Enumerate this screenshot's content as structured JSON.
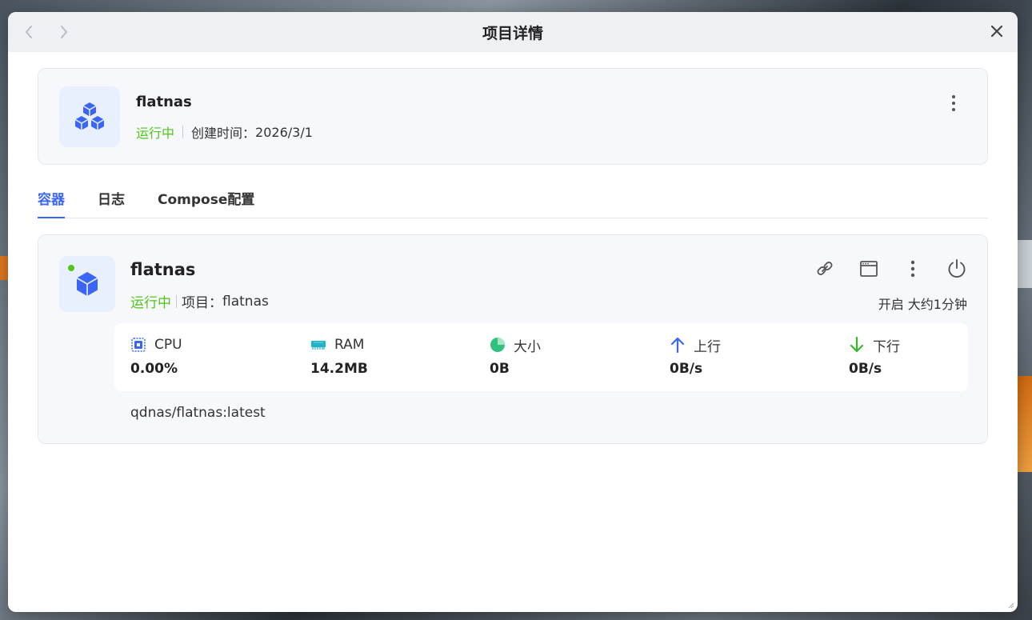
{
  "window": {
    "title": "项目详情"
  },
  "project": {
    "name": "flatnas",
    "status": "运行中",
    "created_label": "创建时间：",
    "created_value": "2026/3/1"
  },
  "tabs": [
    {
      "label": "容器",
      "active": true
    },
    {
      "label": "日志",
      "active": false
    },
    {
      "label": "Compose配置",
      "active": false
    }
  ],
  "container": {
    "name": "flatnas",
    "status": "运行中",
    "project_label": "项目：",
    "project_value": "flatnas",
    "uptime": "开启 大约1分钟",
    "image": "qdnas/flatnas:latest",
    "stats": [
      {
        "label": "CPU",
        "value": "0.00%",
        "icon": "cpu-icon"
      },
      {
        "label": "RAM",
        "value": "14.2MB",
        "icon": "ram-icon"
      },
      {
        "label": "大小",
        "value": "0B",
        "icon": "pie-icon"
      },
      {
        "label": "上行",
        "value": "0B/s",
        "icon": "arrow-up-icon"
      },
      {
        "label": "下行",
        "value": "0B/s",
        "icon": "arrow-down-icon"
      }
    ]
  },
  "colors": {
    "accent": "#3b66f5",
    "status_green": "#52c41a",
    "card_bg": "#f6f8fc"
  }
}
